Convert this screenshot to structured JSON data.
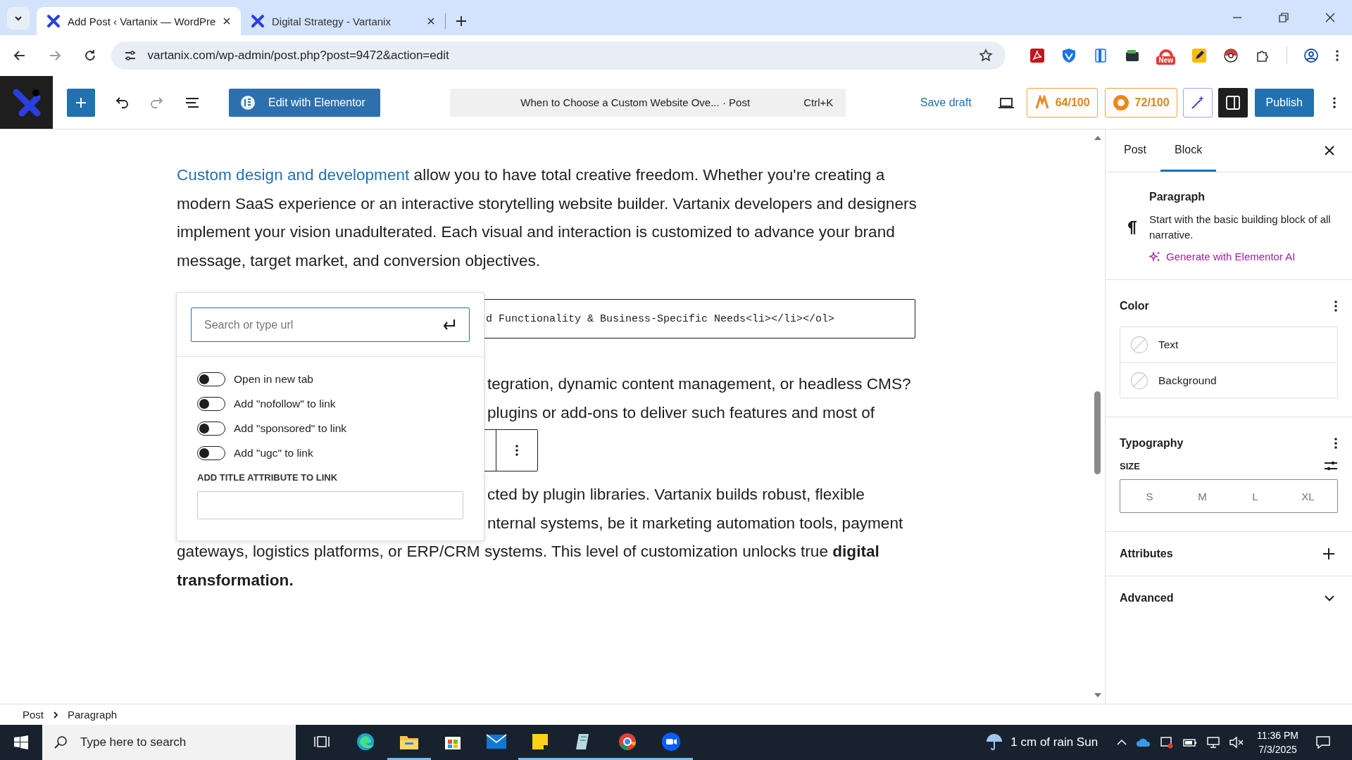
{
  "browser": {
    "tabs": [
      {
        "title": "Add Post ‹ Vartanix — WordPre",
        "selected": true
      },
      {
        "title": "Digital Strategy - Vartanix",
        "selected": false
      }
    ],
    "url": "vartanix.com/wp-admin/post.php?post=9472&action=edit",
    "extension_badge": "New"
  },
  "toolbar": {
    "elementor_button": "Edit with Elementor",
    "command_title": "When to Choose a Custom Website Ove... · Post",
    "shortcut": "Ctrl+K",
    "save_draft": "Save draft",
    "scores": [
      "64/100",
      "72/100"
    ],
    "publish": "Publish"
  },
  "content": {
    "paragraph_1": {
      "link": "Custom design and development",
      "lines": [
        " allow you to have total creative freedom. Whether you're creating a",
        "modern SaaS experience or an interactive storytelling website builder. Vartanix developers and designers",
        "implement your vision unadulterated. Each visual and interaction is customized to advance your brand",
        "message, target market, and conversion objectives."
      ]
    },
    "code_block": "d Functionality & Business-Specific Needs<li></li></ol>",
    "paragraph_2": [
      "tegration, dynamic content management, or headless CMS?",
      "plugins or add-ons to deliver such features and most of"
    ],
    "paragraph_3": [
      {
        "text": "cted by plugin libraries. Vartanix builds robust, flexible",
        "covered": true
      },
      {
        "text": "nternal systems, be it marketing automation tools, payment",
        "covered": true
      },
      {
        "text": "gateways, logistics platforms, or ERP/CRM systems. This level of customization unlocks true **digital** **transformation.**",
        "covered": false
      }
    ]
  },
  "link_popover": {
    "search": {
      "placeholder": "Search or type url"
    },
    "toggles": [
      {
        "label": "Open in new tab",
        "on": false
      },
      {
        "label": "Add \"nofollow\" to link",
        "on": false
      },
      {
        "label": "Add \"sponsored\" to link",
        "on": false
      },
      {
        "label": "Add \"ugc\" to link",
        "on": false
      }
    ],
    "title_attribute_label": "ADD TITLE ATTRIBUTE TO LINK"
  },
  "sidebar": {
    "tabs": [
      {
        "label": "Post",
        "selected": false
      },
      {
        "label": "Block",
        "selected": true
      }
    ],
    "block": {
      "title": "Paragraph",
      "description": "Start with the basic building block of all narrative.",
      "ai_link": "Generate with Elementor AI"
    },
    "color": {
      "title": "Color",
      "items": [
        "Text",
        "Background"
      ]
    },
    "typography": {
      "title": "Typography",
      "size_label": "SIZE",
      "sizes": [
        {
          "label": "S",
          "selected": false
        },
        {
          "label": "M",
          "selected": false
        },
        {
          "label": "L",
          "selected": false
        },
        {
          "label": "XL",
          "selected": false
        }
      ]
    },
    "attributes": {
      "title": "Attributes"
    },
    "advanced": {
      "title": "Advanced"
    }
  },
  "breadcrumb": [
    "Post",
    "Paragraph"
  ],
  "taskbar": {
    "search_placeholder": "Type here to search",
    "apps": [
      {
        "kind": "taskview",
        "running": false
      },
      {
        "kind": "edge",
        "running": false
      },
      {
        "kind": "explorer",
        "running": true
      },
      {
        "kind": "store",
        "running": false
      },
      {
        "kind": "mail",
        "running": false
      },
      {
        "kind": "sticky",
        "running": true
      },
      {
        "kind": "notes",
        "running": true
      },
      {
        "kind": "chrome",
        "running": true
      },
      {
        "kind": "zoom",
        "running": true
      }
    ],
    "weather": "1 cm of rain Sun",
    "time": "11:36 PM",
    "date": "7/3/2025"
  }
}
